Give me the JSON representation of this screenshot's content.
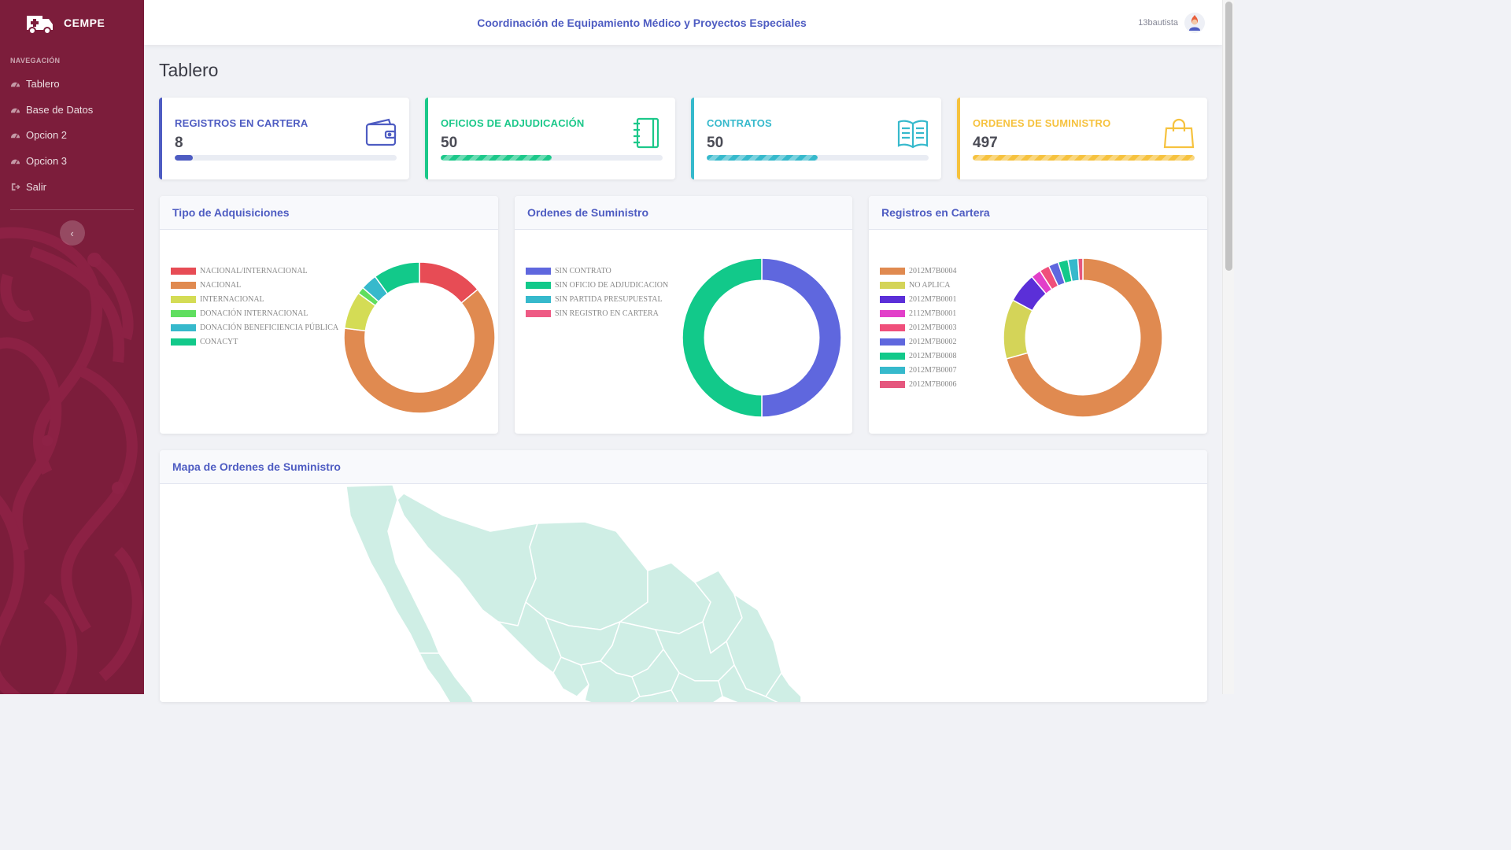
{
  "brand": {
    "name": "CEMPE"
  },
  "sidebar": {
    "heading": "NAVEGACIÓN",
    "items": [
      {
        "label": "Tablero",
        "icon": "dashboard-icon"
      },
      {
        "label": "Base de Datos",
        "icon": "dashboard-icon"
      },
      {
        "label": "Opcion 2",
        "icon": "dashboard-icon"
      },
      {
        "label": "Opcion 3",
        "icon": "dashboard-icon"
      },
      {
        "label": "Salir",
        "icon": "sign-out-icon"
      }
    ],
    "toggle_icon": "chevron-left-icon",
    "color": "#7c1d3b"
  },
  "topbar": {
    "title": "Coordinación de Equipamiento Médico y Proyectos Especiales",
    "user": "13bautista"
  },
  "page": {
    "title": "Tablero"
  },
  "stats": [
    {
      "label": "REGISTROS EN CARTERA",
      "value": "8",
      "color": "#4e5cc2",
      "progress": 0.08,
      "icon": "wallet-icon"
    },
    {
      "label": "OFICIOS DE ADJUDICACIÓN",
      "value": "50",
      "color": "#1cc88a",
      "progress": 0.5,
      "icon": "notebook-icon"
    },
    {
      "label": "CONTRATOS",
      "value": "50",
      "color": "#36b9cc",
      "progress": 0.5,
      "icon": "book-open-icon"
    },
    {
      "label": "ORDENES DE SUMINISTRO",
      "value": "497",
      "color": "#f6c23e",
      "progress": 1.0,
      "icon": "shopping-bag-icon"
    }
  ],
  "chart_data": [
    {
      "type": "pie",
      "title": "Tipo de Adquisiciones",
      "categories": [
        "NACIONAL/INTERNACIONAL",
        "NACIONAL",
        "INTERNACIONAL",
        "DONACIÓN INTERNACIONAL",
        "DONACIÓN BENEFICIENCIA PÚBLICA",
        "CONACYT"
      ],
      "values": [
        14,
        63,
        8,
        1.5,
        3.5,
        10
      ],
      "colors": [
        "#e74c55",
        "#e08a50",
        "#d4dc55",
        "#5fde5f",
        "#36b9cc",
        "#12c98a"
      ],
      "legend": "left"
    },
    {
      "type": "pie",
      "title": "Ordenes de Suministro",
      "categories": [
        "SIN CONTRATO",
        "SIN OFICIO DE ADJUDICACION",
        "SIN PARTIDA PRESUPUESTAL",
        "SIN REGISTRO EN CARTERA"
      ],
      "values": [
        50,
        50,
        0,
        0
      ],
      "colors": [
        "#5f67de",
        "#12c98a",
        "#36b9cc",
        "#ee5a84"
      ],
      "legend": "left"
    },
    {
      "type": "pie",
      "title": "Registros en Cartera",
      "categories": [
        "2012M7B0004",
        "NO APLICA",
        "2012M7B0001",
        "2112M7B0001",
        "2012M7B0003",
        "2012M7B0002",
        "2012M7B0008",
        "2012M7B0007",
        "2012M7B0006"
      ],
      "values": [
        70,
        12,
        6,
        2,
        2,
        2,
        2,
        2,
        1
      ],
      "colors": [
        "#e08a50",
        "#d4d458",
        "#5b2fd8",
        "#e23fc9",
        "#f04f7b",
        "#5f67de",
        "#12c98a",
        "#36b9cc",
        "#e5577e"
      ],
      "legend": "left"
    }
  ],
  "map": {
    "title": "Mapa de Ordenes de Suministro",
    "fill": "#cfeee5"
  }
}
